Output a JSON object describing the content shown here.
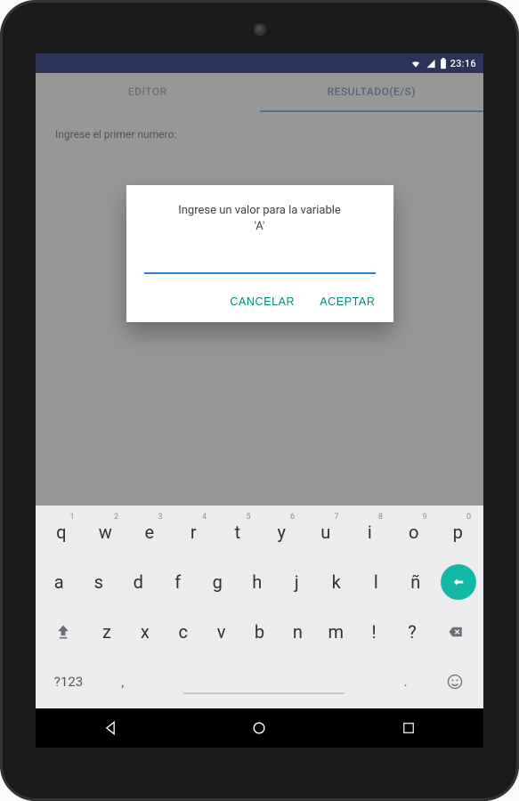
{
  "status": {
    "time": "23:16"
  },
  "tabs": {
    "editor": "EDITOR",
    "resultado": "RESULTADO(E/S)"
  },
  "content": {
    "prompt": "Ingrese el primer numero:"
  },
  "dialog": {
    "title_line1": "Ingrese un valor para la variable",
    "title_line2": "'A'",
    "input_value": "",
    "cancel": "CANCELAR",
    "accept": "ACEPTAR"
  },
  "keyboard": {
    "row1": [
      {
        "main": "q",
        "hint": "1"
      },
      {
        "main": "w",
        "hint": "2"
      },
      {
        "main": "e",
        "hint": "3"
      },
      {
        "main": "r",
        "hint": "4"
      },
      {
        "main": "t",
        "hint": "5"
      },
      {
        "main": "y",
        "hint": "6"
      },
      {
        "main": "u",
        "hint": "7"
      },
      {
        "main": "i",
        "hint": "8"
      },
      {
        "main": "o",
        "hint": "9"
      },
      {
        "main": "p",
        "hint": "0"
      }
    ],
    "row2": [
      {
        "main": "a"
      },
      {
        "main": "s"
      },
      {
        "main": "d"
      },
      {
        "main": "f"
      },
      {
        "main": "g"
      },
      {
        "main": "h"
      },
      {
        "main": "j"
      },
      {
        "main": "k"
      },
      {
        "main": "l"
      },
      {
        "main": "ñ"
      }
    ],
    "row3": [
      {
        "main": "z"
      },
      {
        "main": "x"
      },
      {
        "main": "c"
      },
      {
        "main": "v"
      },
      {
        "main": "b"
      },
      {
        "main": "n"
      },
      {
        "main": "m"
      },
      {
        "main": "!"
      },
      {
        "main": "?"
      }
    ],
    "row4": {
      "sym": "?123",
      "comma": ",",
      "period": "."
    }
  }
}
